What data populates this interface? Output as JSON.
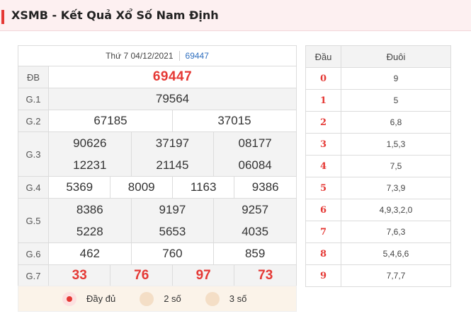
{
  "header": {
    "title": "XSMB - Kết Quả Xổ Số Nam Định",
    "accent": "#e53935"
  },
  "draw": {
    "date": "Thứ 7 04/12/2021",
    "code": "69447"
  },
  "prizes": {
    "db": {
      "label": "ĐB",
      "values": [
        "69447"
      ]
    },
    "g1": {
      "label": "G.1",
      "values": [
        "79564"
      ]
    },
    "g2": {
      "label": "G.2",
      "values": [
        "67185",
        "37015"
      ]
    },
    "g3": {
      "label": "G.3",
      "values": [
        "90626",
        "37197",
        "08177",
        "12231",
        "21145",
        "06084"
      ]
    },
    "g4": {
      "label": "G.4",
      "values": [
        "5369",
        "8009",
        "1163",
        "9386"
      ]
    },
    "g5": {
      "label": "G.5",
      "values": [
        "8386",
        "9197",
        "9257",
        "5228",
        "5653",
        "4035"
      ]
    },
    "g6": {
      "label": "G.6",
      "values": [
        "462",
        "760",
        "859"
      ]
    },
    "g7": {
      "label": "G.7",
      "values": [
        "33",
        "76",
        "97",
        "73"
      ]
    }
  },
  "display_options": {
    "full": "Đầy đủ",
    "two": "2 số",
    "three": "3 số",
    "selected": "full"
  },
  "loto": {
    "head_col": "Đầu",
    "tail_col": "Đuôi",
    "rows": [
      {
        "head": "0",
        "tail": "9"
      },
      {
        "head": "1",
        "tail": "5"
      },
      {
        "head": "2",
        "tail": "6,8"
      },
      {
        "head": "3",
        "tail": "1,5,3"
      },
      {
        "head": "4",
        "tail": "7,5"
      },
      {
        "head": "5",
        "tail": "7,3,9"
      },
      {
        "head": "6",
        "tail": "4,9,3,2,0"
      },
      {
        "head": "7",
        "tail": "7,6,3"
      },
      {
        "head": "8",
        "tail": "5,4,6,6"
      },
      {
        "head": "9",
        "tail": "7,7,7"
      }
    ]
  }
}
